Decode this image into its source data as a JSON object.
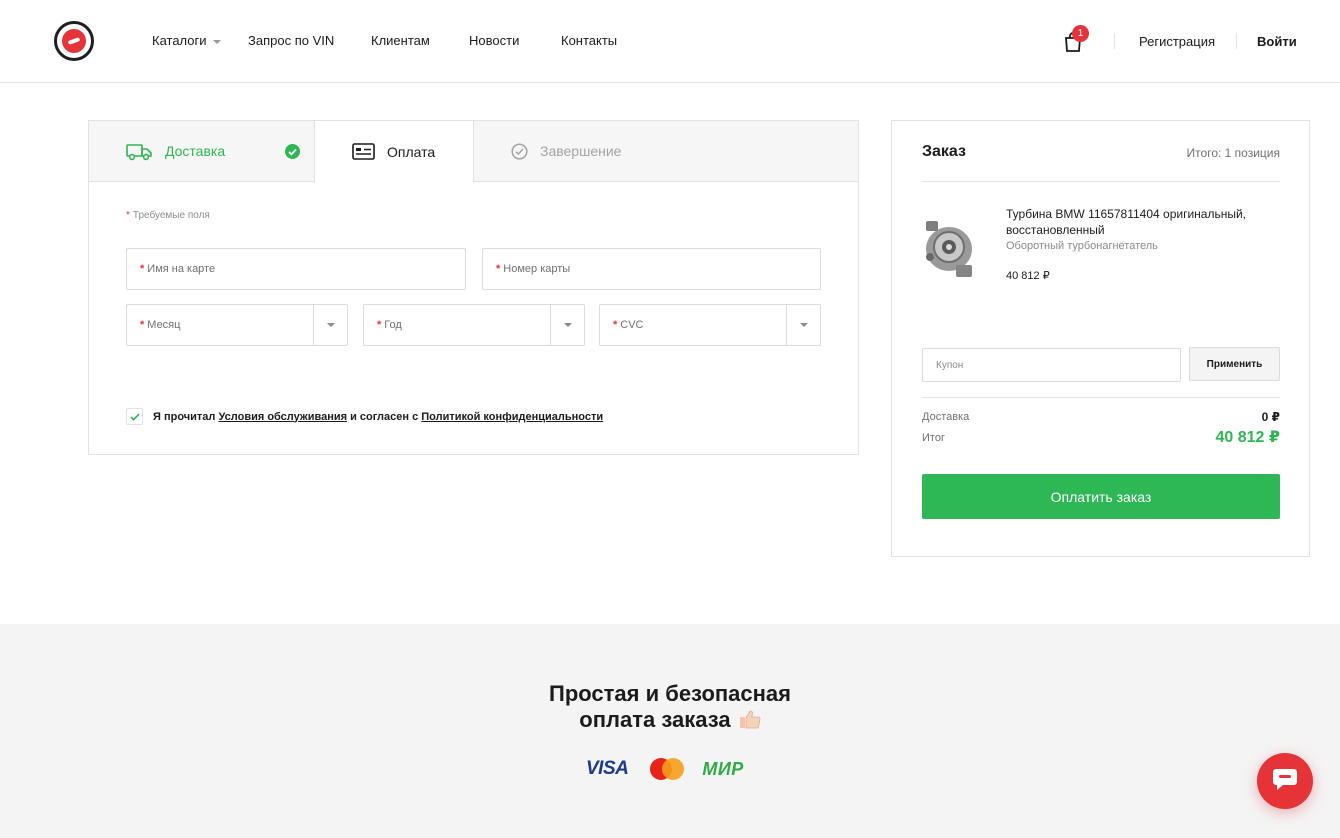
{
  "header": {
    "nav": [
      {
        "label": "Каталоги",
        "has_dropdown": true
      },
      {
        "label": "Запрос по VIN"
      },
      {
        "label": "Клиентам"
      },
      {
        "label": "Новости"
      },
      {
        "label": "Контакты"
      }
    ],
    "cart_count": "1",
    "register_label": "Регистрация",
    "login_label": "Войти"
  },
  "checkout": {
    "tabs": {
      "delivery": "Доставка",
      "payment": "Оплата",
      "finish": "Завершение"
    },
    "required_note": "Требуемые поля",
    "fields": {
      "card_name": "Имя на карте",
      "card_number": "Номер карты",
      "month": "Месяц",
      "year": "Год",
      "cvc": "CVC"
    },
    "agreement": {
      "prefix": "Я прочитал",
      "terms_link": "Условия обслуживания",
      "middle": "и согласен с",
      "privacy_link": "Политикой конфиденциальности",
      "checked": true
    }
  },
  "order": {
    "title": "Заказ",
    "total_count_label": "Итого: 1 позиция",
    "product": {
      "name": "Турбина BMW 11657811404 оригинальный, восстановленный",
      "subtitle": "Оборотный турбонагнетатель",
      "price": "40 812 ₽"
    },
    "coupon_placeholder": "Купон",
    "apply_label": "Применить",
    "delivery_label": "Доставка",
    "delivery_value": "0 ₽",
    "total_label": "Итог",
    "total_value": "40 812 ₽",
    "pay_button": "Оплатить заказ"
  },
  "footer": {
    "title_line1": "Простая и безопасная",
    "title_line2": "оплата заказа",
    "visa": "VISA",
    "mir": "МИР"
  },
  "colors": {
    "accent_green": "#2eb755",
    "brand_red": "#e63338"
  }
}
